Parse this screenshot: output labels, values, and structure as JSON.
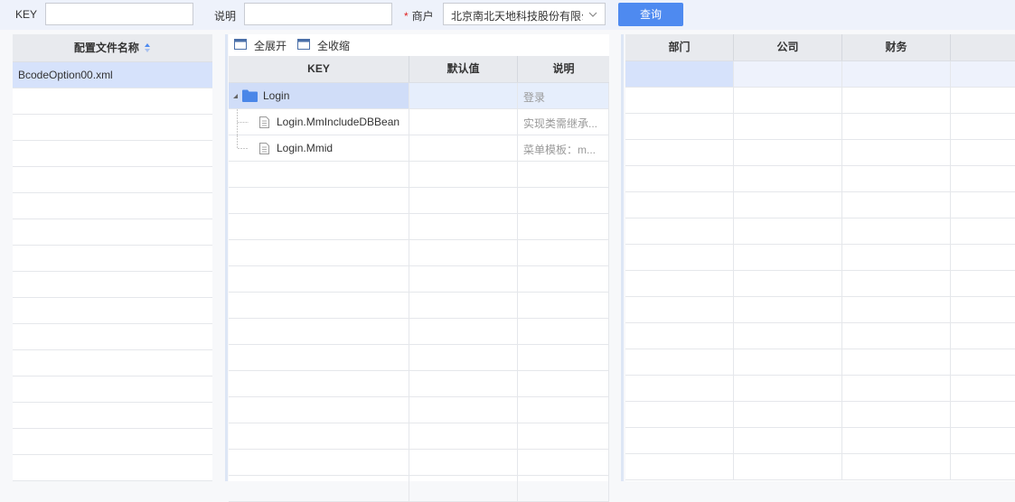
{
  "toolbar": {
    "key_label": "KEY",
    "key_value": "",
    "desc_label": "说明",
    "desc_value": "",
    "required_mark": "*",
    "merchant_label": "商户",
    "merchant_value": "北京南北天地科技股份有限公",
    "query_button": "查询"
  },
  "left_panel": {
    "header": "配置文件名称",
    "files": [
      "BcodeOption00.xml"
    ]
  },
  "middle_panel": {
    "expand_all": "全展开",
    "collapse_all": "全收缩",
    "columns": [
      "KEY",
      "默认值",
      "说明"
    ],
    "rows": [
      {
        "key": "Login",
        "default": "",
        "desc": "登录"
      },
      {
        "key": "Login.MmIncludeDBBean",
        "default": "",
        "desc": "实现类需继承..."
      },
      {
        "key": "Login.Mmid",
        "default": "",
        "desc": "菜单模板：m..."
      }
    ]
  },
  "right_panel": {
    "columns": [
      "部门",
      "公司",
      "财务",
      ""
    ]
  },
  "colors": {
    "accent": "#4e8af0",
    "selection": "#d6e2fb",
    "folder": "#4a86e8"
  }
}
